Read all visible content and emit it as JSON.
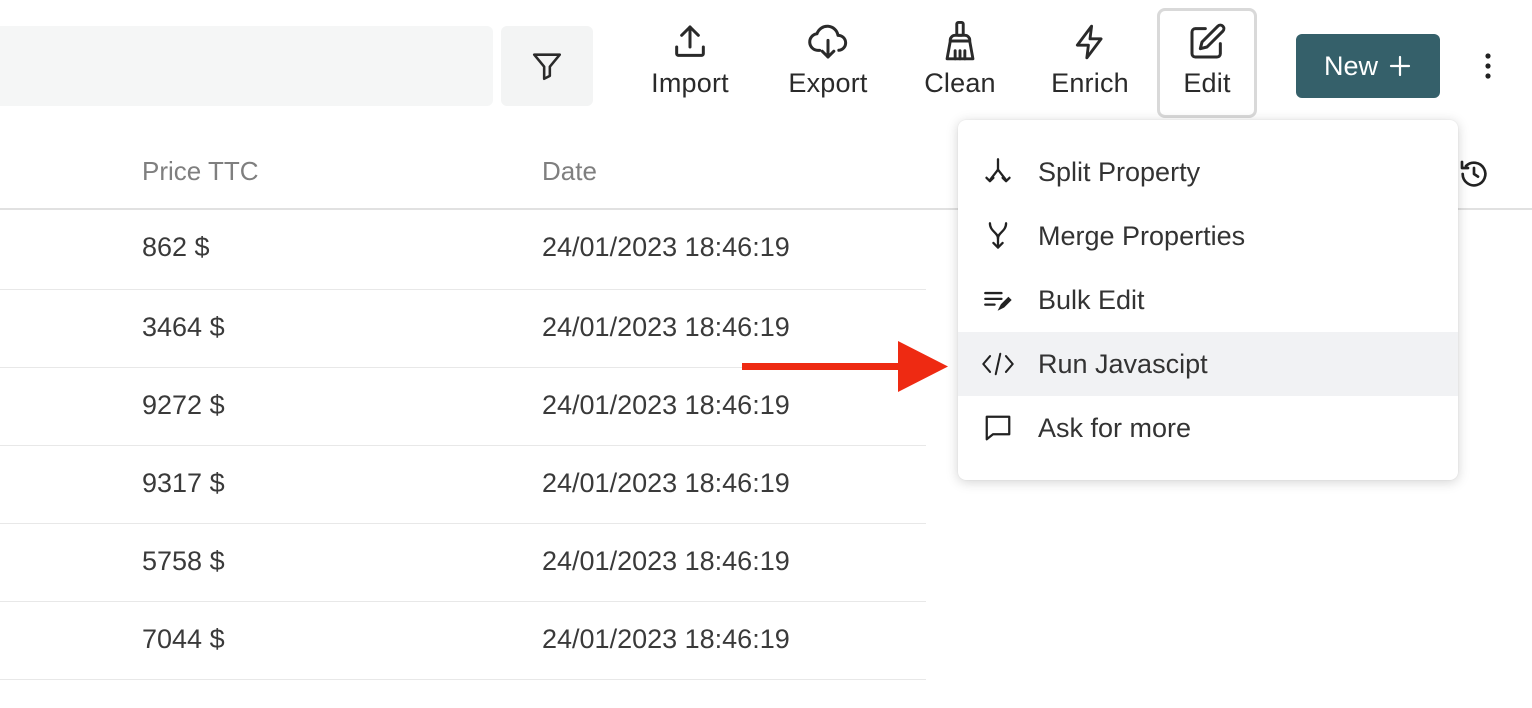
{
  "toolbar": {
    "import_label": "Import",
    "export_label": "Export",
    "clean_label": "Clean",
    "enrich_label": "Enrich",
    "edit_label": "Edit",
    "new_label": "New",
    "new_icon": "plus-icon"
  },
  "colors": {
    "accent": "#35606a",
    "arrow": "#ee2a12",
    "active_item_bg": "#f1f2f4"
  },
  "table": {
    "columns": [
      "Price TTC",
      "Date"
    ],
    "rows": [
      {
        "price": "862 $",
        "date": "24/01/2023 18:46:19"
      },
      {
        "price": "3464 $",
        "date": "24/01/2023 18:46:19"
      },
      {
        "price": "9272 $",
        "date": "24/01/2023 18:46:19"
      },
      {
        "price": "9317 $",
        "date": "24/01/2023 18:46:19"
      },
      {
        "price": "5758 $",
        "date": "24/01/2023 18:46:19"
      },
      {
        "price": "7044 $",
        "date": "24/01/2023 18:46:19"
      }
    ]
  },
  "edit_menu": {
    "items": [
      {
        "label": "Split Property",
        "icon": "split-icon"
      },
      {
        "label": "Merge Properties",
        "icon": "merge-icon"
      },
      {
        "label": "Bulk Edit",
        "icon": "bulk-edit-icon"
      },
      {
        "label": "Run Javascipt",
        "icon": "code-icon",
        "highlighted": true
      },
      {
        "label": "Ask for more",
        "icon": "chat-bubble-icon"
      }
    ]
  }
}
